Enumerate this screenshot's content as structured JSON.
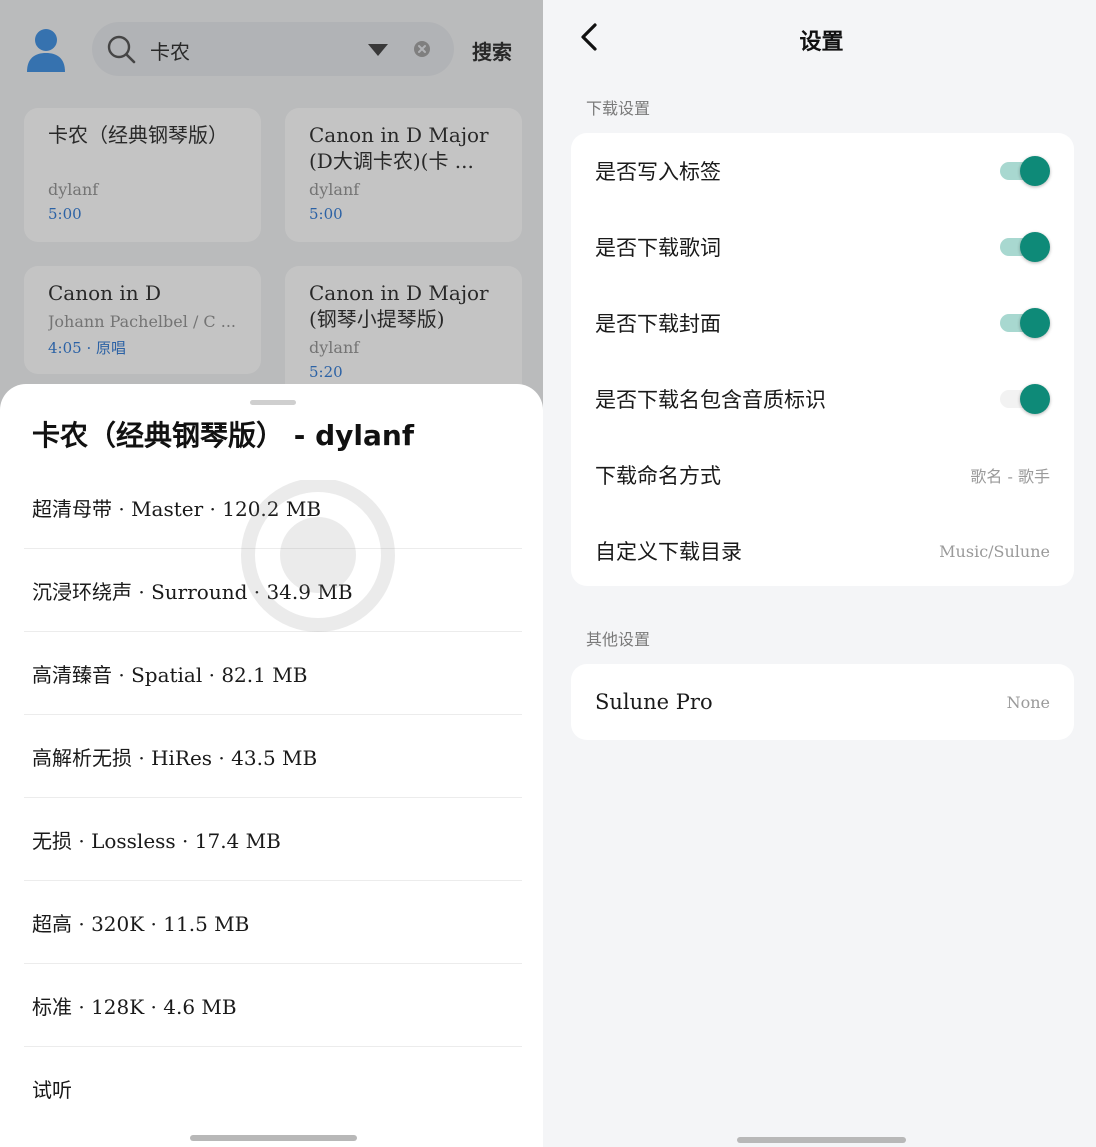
{
  "search": {
    "query": "卡农",
    "button_label": "搜索"
  },
  "results": [
    {
      "title": "卡农（经典钢琴版）",
      "artist": "dylanf",
      "meta": "5:00"
    },
    {
      "title": "Canon in D Major (D大调卡农)(卡 ...",
      "artist": "dylanf",
      "meta": "5:00"
    },
    {
      "title": "Canon in D",
      "artist": "Johann Pachelbel / C ...",
      "meta": "4:05 · 原唱"
    },
    {
      "title": "Canon in D Major (钢琴小提琴版)",
      "artist": "dylanf",
      "meta": "5:20"
    }
  ],
  "sheet": {
    "title": "卡农（经典钢琴版） - dylanf",
    "qualities": [
      "超清母带 · Master · 120.2 MB",
      "沉浸环绕声 · Surround · 34.9 MB",
      "高清臻音 · Spatial · 82.1 MB",
      "高解析无损 · HiRes · 43.5 MB",
      "无损 · Lossless · 17.4 MB",
      "超高 · 320K · 11.5 MB",
      "标准 · 128K · 4.6 MB",
      "试听"
    ]
  },
  "settings": {
    "title": "设置",
    "download_section": "下载设置",
    "download_items": [
      {
        "label": "是否写入标签",
        "toggle": true
      },
      {
        "label": "是否下载歌词",
        "toggle": true
      },
      {
        "label": "是否下载封面",
        "toggle": true
      },
      {
        "label": "是否下载名包含音质标识",
        "toggle": true
      },
      {
        "label": "下载命名方式",
        "value": "歌名 - 歌手"
      },
      {
        "label": "自定义下载目录",
        "value": "Music/Sulune"
      }
    ],
    "other_section": "其他设置",
    "other_items": [
      {
        "label": "Sulune Pro",
        "value": "None"
      }
    ]
  },
  "colors": {
    "accent": "#0e8a78",
    "accent_track": "#a8d8d0",
    "link_blue": "#1f6fd1",
    "avatar_blue": "#2f86e0"
  }
}
